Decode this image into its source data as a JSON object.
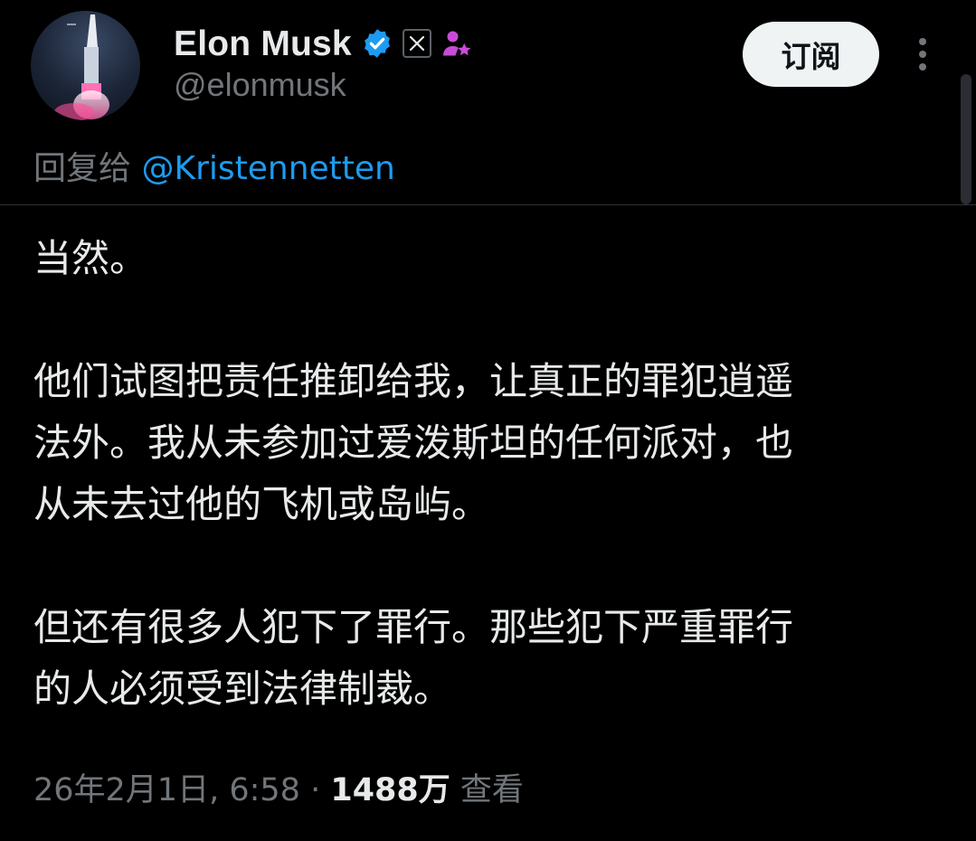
{
  "header": {
    "display_name": "Elon Musk",
    "handle": "@elonmusk",
    "subscribe_label": "订阅",
    "icons": {
      "verified": "verified-badge-icon",
      "x_affiliation": "x-logo-icon",
      "affiliate": "affiliate-person-icon",
      "more": "more-vertical-icon"
    },
    "colors": {
      "verified": "#1d9bf0",
      "affiliate": "#c84bd8"
    }
  },
  "reply": {
    "prefix": "回复给",
    "mention": "@Kristennetten"
  },
  "tweet": {
    "paragraph1": "当然。",
    "paragraph2_line1": "他们试图把责任推卸给我，让真正的罪犯逍遥",
    "paragraph2_line2": "法外。我从未参加过爱泼斯坦的任何派对，也",
    "paragraph2_line3": "从未去过他的飞机或岛屿。",
    "paragraph3_line1": "但还有很多人犯下了罪行。那些犯下严重罪行",
    "paragraph3_line2": "的人必须受到法律制裁。"
  },
  "meta": {
    "timestamp": "26年2月1日, 6:58",
    "separator": "·",
    "views_count": "1488万",
    "views_label": "查看"
  },
  "colors": {
    "background": "#000000",
    "text_primary": "#e7e9ea",
    "text_secondary": "#71767b",
    "link": "#1d9bf0",
    "button_bg": "#eff3f4"
  }
}
